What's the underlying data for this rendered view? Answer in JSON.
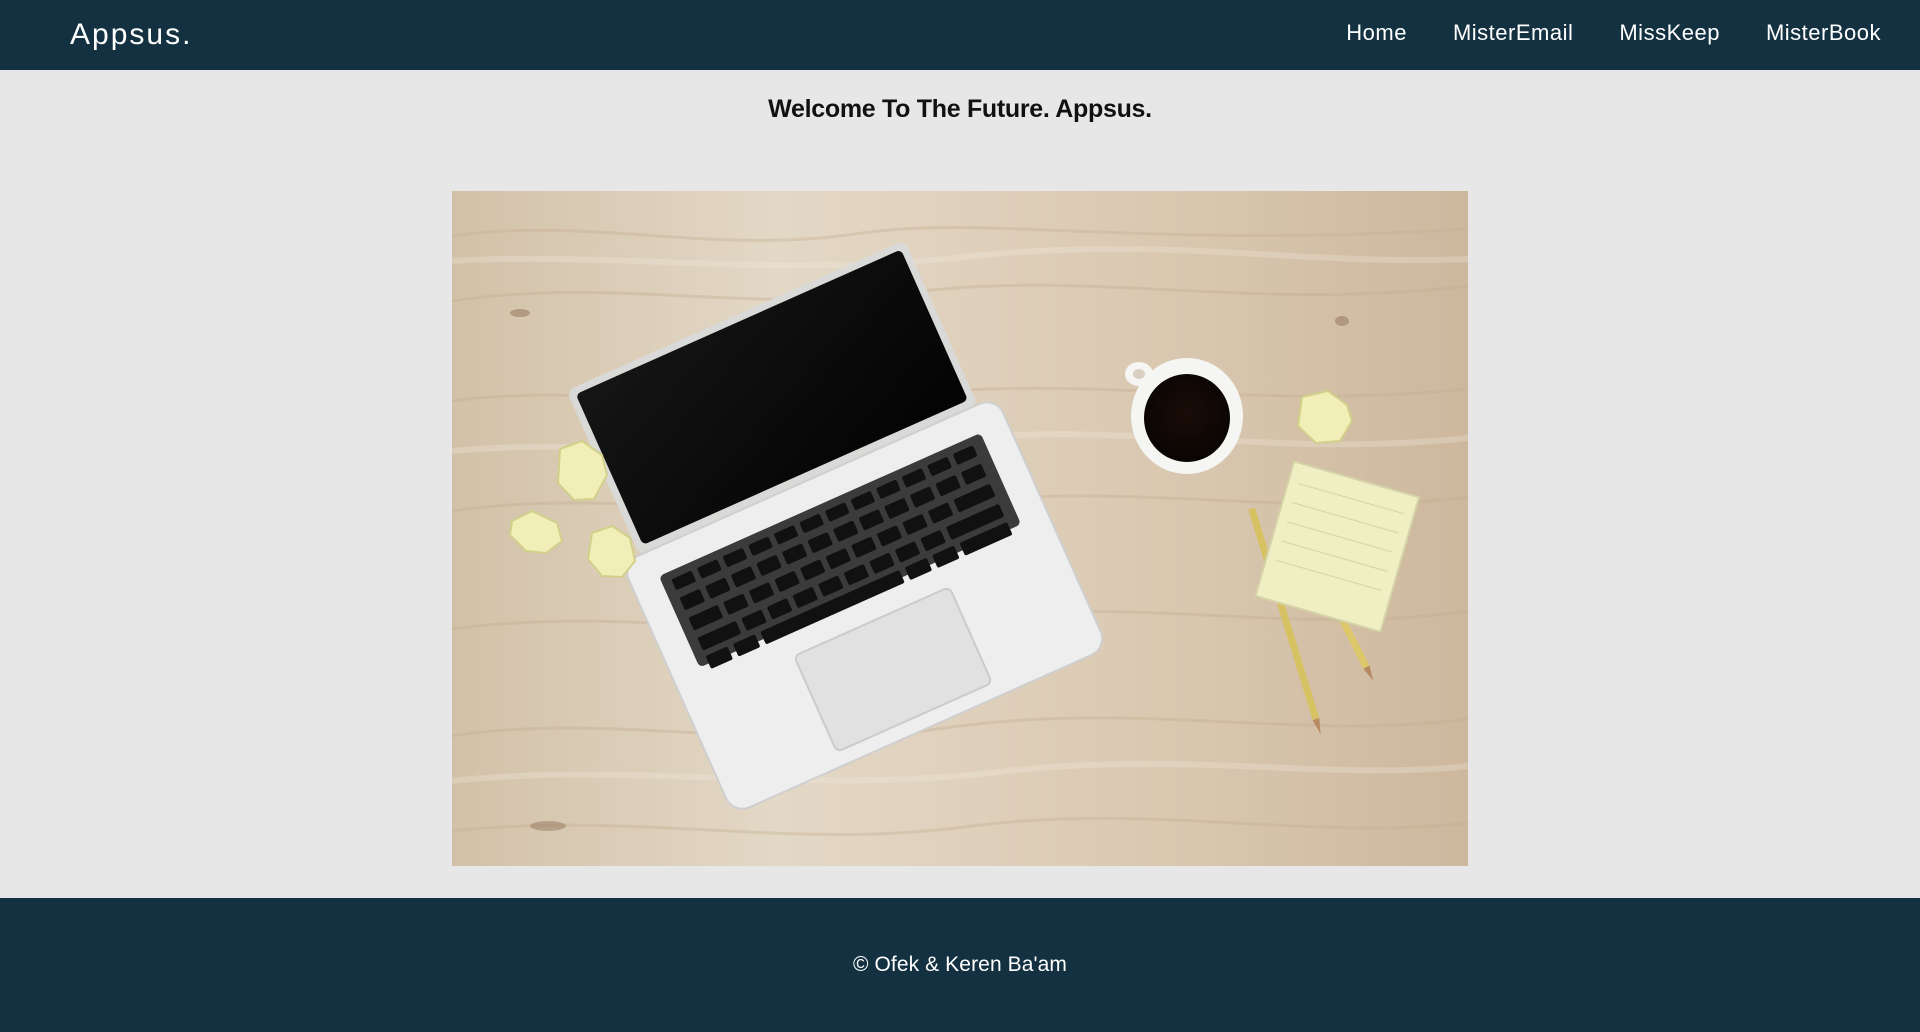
{
  "header": {
    "logo": "Appsus.",
    "nav": [
      "Home",
      "MisterEmail",
      "MissKeep",
      "MisterBook"
    ]
  },
  "main": {
    "welcome": "Welcome To The Future. Appsus.",
    "hero_image": "laptop-desk-photo"
  },
  "footer": {
    "copyright": "© Ofek & Keren Ba'am"
  },
  "colors": {
    "header_bg": "#133141",
    "page_bg": "#e8e7e7",
    "footer_bg": "#133141"
  }
}
